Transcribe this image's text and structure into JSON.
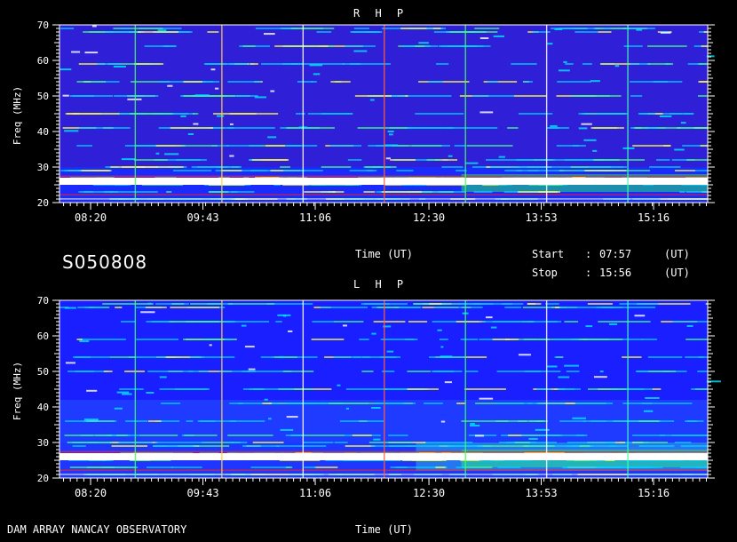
{
  "footer": {
    "observatory": "DAM ARRAY   NANCAY OBSERVATORY"
  },
  "station_id": "S050808",
  "time_block": {
    "axis_label": "Time (UT)",
    "start_label": "Start",
    "stop_label": "Stop",
    "colon": ":",
    "start_value": "07:57",
    "stop_value": "15:56",
    "unit": "(UT)"
  },
  "chart_data": [
    {
      "type": "heatmap",
      "title": "R H P",
      "ylabel": "Freq (MHz)",
      "xlabel": "",
      "ylim": [
        20,
        70
      ],
      "xlim": [
        "07:57",
        "15:56"
      ],
      "y_ticks": [
        20,
        30,
        40,
        50,
        60,
        70
      ],
      "x_ticks": [
        "08:20",
        "09:43",
        "11:06",
        "12:30",
        "13:53",
        "15:16"
      ],
      "colors": {
        "background": "#2f1fd6",
        "low": "#1a2cff",
        "mid": "#00d0ff",
        "high": "#ffffff",
        "peak": "#ff2020"
      },
      "interference_bands_mhz": [
        21,
        23,
        25,
        26,
        27,
        29,
        30,
        32,
        36,
        41,
        45,
        50,
        54,
        59,
        64,
        68,
        69
      ],
      "vertical_markers_ut": [
        "08:53",
        "09:57",
        "10:57",
        "11:57",
        "12:57",
        "13:57",
        "14:57"
      ]
    },
    {
      "type": "heatmap",
      "title": "L H P",
      "ylabel": "Freq (MHz)",
      "xlabel": "Time (UT)",
      "ylim": [
        20,
        70
      ],
      "xlim": [
        "07:57",
        "15:56"
      ],
      "y_ticks": [
        20,
        30,
        40,
        50,
        60,
        70
      ],
      "x_ticks": [
        "08:20",
        "09:43",
        "11:06",
        "12:30",
        "13:53",
        "15:16"
      ],
      "colors": {
        "background": "#1a1fff",
        "low": "#2038ff",
        "mid": "#00d0ff",
        "high": "#ffffff",
        "peak": "#ff2020"
      },
      "interference_bands_mhz": [
        21,
        23,
        25,
        26,
        27,
        29,
        30,
        32,
        36,
        41,
        45,
        50,
        54,
        59,
        64,
        68,
        69
      ],
      "vertical_markers_ut": [
        "08:53",
        "09:57",
        "10:57",
        "11:57",
        "12:57",
        "13:57",
        "14:57"
      ]
    }
  ]
}
